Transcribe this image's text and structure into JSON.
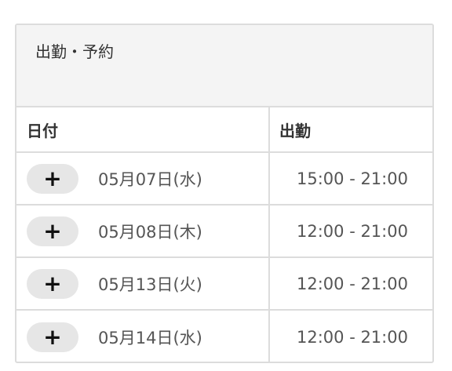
{
  "panel": {
    "title": "出勤・予約"
  },
  "table": {
    "headers": {
      "date": "日付",
      "shift": "出勤"
    },
    "add_glyph": "+",
    "rows": [
      {
        "date": "05月07日(水)",
        "shift": "15:00 - 21:00"
      },
      {
        "date": "05月08日(木)",
        "shift": "12:00 - 21:00"
      },
      {
        "date": "05月13日(火)",
        "shift": "12:00 - 21:00"
      },
      {
        "date": "05月14日(水)",
        "shift": "12:00 - 21:00"
      }
    ]
  }
}
